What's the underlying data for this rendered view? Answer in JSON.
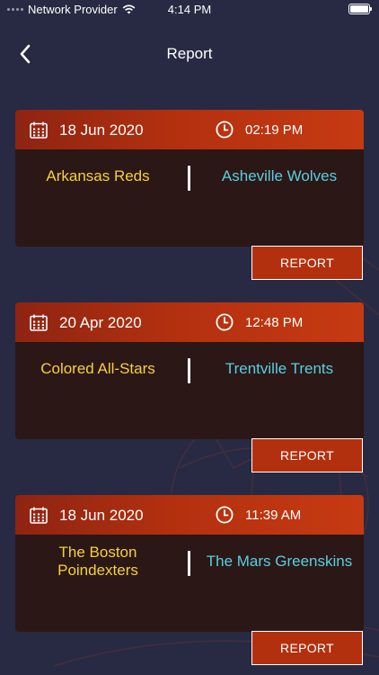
{
  "status_bar": {
    "carrier": "Network Provider",
    "time": "4:14 PM"
  },
  "header": {
    "title": "Report"
  },
  "colors": {
    "background": "#272a42",
    "card_header": "#b3300f",
    "card_body": "#2b1716",
    "home_team": "#f4d13b",
    "away_team": "#58cfe0"
  },
  "icons": {
    "back": "chevron-left-icon",
    "date": "calendar-icon",
    "time": "clock-icon"
  },
  "reports": [
    {
      "date": "18 Jun 2020",
      "time": "02:19 PM",
      "home_team": "Arkansas Reds",
      "away_team": "Asheville Wolves",
      "button_label": "REPORT"
    },
    {
      "date": "20 Apr 2020",
      "time": "12:48 PM",
      "home_team": "Colored All-Stars",
      "away_team": "Trentville Trents",
      "button_label": "REPORT"
    },
    {
      "date": "18 Jun 2020",
      "time": "11:39 AM",
      "home_team": "The Boston Poindexters",
      "away_team": "The Mars Greenskins",
      "button_label": "REPORT"
    }
  ]
}
